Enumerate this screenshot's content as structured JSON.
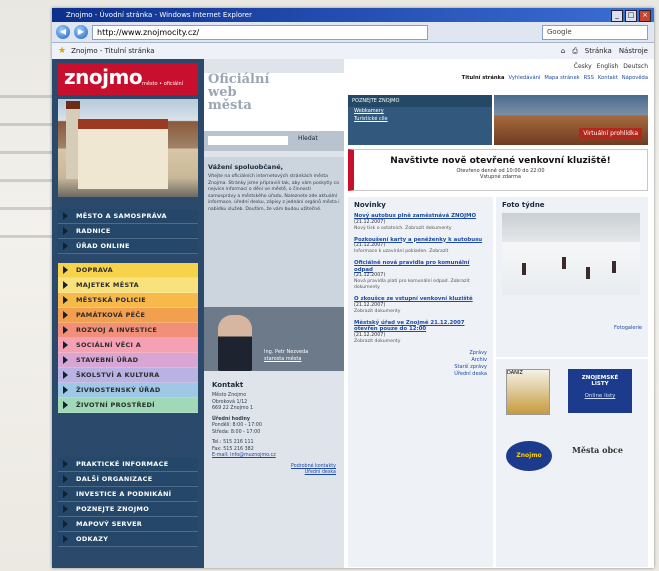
{
  "browser": {
    "title": "Znojmo - Úvodní stránka - Windows Internet Explorer",
    "url": "http://www.znojmocity.cz/",
    "search_placeholder": "Google",
    "tab_label": "Znojmo - Titulní stránka",
    "tools": [
      "Stránka",
      "Nástroje"
    ]
  },
  "site": {
    "logo": "znojmo",
    "logo_sub": "město • oficiální",
    "web_title": [
      "Oficiální",
      "web",
      "města"
    ],
    "search_button": "Hledat",
    "languages": [
      "Česky",
      "English",
      "Deutsch"
    ],
    "top_links": [
      "Titulní stránka",
      "Vyhledávání",
      "Mapa stránek",
      "RSS",
      "Kontakt",
      "Nápověda"
    ],
    "nav_top": [
      "MĚSTO A SAMOSPRÁVA",
      "RADNICE",
      "ÚŘAD ONLINE"
    ],
    "nav_color": [
      {
        "label": "DOPRAVA",
        "color": "#f6d34a"
      },
      {
        "label": "MAJETEK MĚSTA",
        "color": "#f9e27c"
      },
      {
        "label": "MĚSTSKÁ POLICIE",
        "color": "#f6b94a"
      },
      {
        "label": "PAMÁTKOVÁ PÉČE",
        "color": "#f3a04e"
      },
      {
        "label": "ROZVOJ A INVESTICE",
        "color": "#f28f78"
      },
      {
        "label": "SOCIÁLNÍ VĚCI A ZDRAVOTNICTVÍ",
        "color": "#f5a0b3"
      },
      {
        "label": "STAVEBNÍ ÚŘAD",
        "color": "#d7a6d4"
      },
      {
        "label": "ŠKOLSTVÍ A KULTURA",
        "color": "#b9b2e3"
      },
      {
        "label": "ŽIVNOSTENSKÝ ÚŘAD",
        "color": "#9fc8e6"
      },
      {
        "label": "ŽIVOTNÍ PROSTŘEDÍ",
        "color": "#9fd9b8"
      }
    ],
    "nav_bottom": [
      "PRAKTICKÉ INFORMACE",
      "DALŠÍ ORGANIZACE",
      "INVESTICE A PODNIKÁNÍ",
      "POZNEJTE ZNOJMO",
      "MAPOVÝ SERVER",
      "ODKAZY"
    ],
    "welcome_heading": "Vážení spoluobčané,",
    "welcome_text": "Vítejte na oficiálních internetových stránkách města Znojma. Stránky jsme připravili tak, aby vám poskytly co nejvíce informací o dění ve městě, o činnosti samosprávy a městského úřadu. Naleznete zde aktuální informace, úřední desku, zápisy z jednání orgánů města i nabídku služeb. Doufám, že vám budou užitečné.",
    "mayor_caption": [
      "Ing. Petr Nezveda",
      "starosta města"
    ],
    "contact_heading": "Kontakt",
    "contact_address": [
      "Město Znojmo",
      "Obroková 1/12",
      "669 22 Znojmo 1"
    ],
    "contact_hours_label": "Úřední hodiny",
    "contact_hours": [
      "Pondělí: 8:00 - 17:00",
      "Středa: 8:00 - 17:00"
    ],
    "contact_phone": "Tel.: 515 216 111",
    "contact_fax": "Fax: 515 216 382",
    "contact_email": "E-mail: info@muznojmo.cz",
    "contact_links": [
      "Podrobné kontakty",
      "Úřední deska"
    ],
    "quick_box": {
      "heading": "POZNEJTE ZNOJMO",
      "links": [
        "Webkamery",
        "Turistické cíle"
      ]
    },
    "banner_tag": "Virtuální prohlídka",
    "promo_title": "Navštivte nově otevřené venkovní kluziště!",
    "promo_sub": "Otevřeno denně od 10:00 do 22:00",
    "promo_sub2": "Vstupné zdarma",
    "news_heading": "Novinky",
    "news": [
      {
        "title": "Nový autobus plně zaměstnává ZNOJMO",
        "date": "(21.12.2007)",
        "body": "Nový tisk o ostatních. Zobrazit dokumenty"
      },
      {
        "title": "Pozkoušení karty a peněženky k autobusu",
        "date": "(21.12.2007)",
        "body": "Informace k uzavírání pokladen. Zobrazit"
      },
      {
        "title": "Oficiálně nová pravidla pro komunální odpad",
        "date": "(21.12.2007)",
        "body": "Nová pravidla platí pro komunální odpad. Zobrazit dokumenty"
      },
      {
        "title": "O zkoušce ze vstupní venkovní kluziště",
        "date": "(21.12.2007)",
        "body": "Zobrazit dokumenty"
      },
      {
        "title": "Městský úřad ve Znojmě 21.12.2007 otevřen pouze do 12:00",
        "date": "(21.12.2007)",
        "body": "Zobrazit dokumenty"
      }
    ],
    "news_more": [
      "Zprávy",
      "Archiv",
      "Starší zprávy",
      "Úřední deska"
    ],
    "photo_heading": "Foto týdne",
    "photo_more": "Fotogalerie",
    "ads": {
      "ad1": "DANIZ",
      "ad2": [
        "ZNOJEMSKÉ",
        "LISTY"
      ],
      "ad2_link": "Online listy",
      "ad3": "Znojmo",
      "ad4": "Města obce"
    }
  }
}
